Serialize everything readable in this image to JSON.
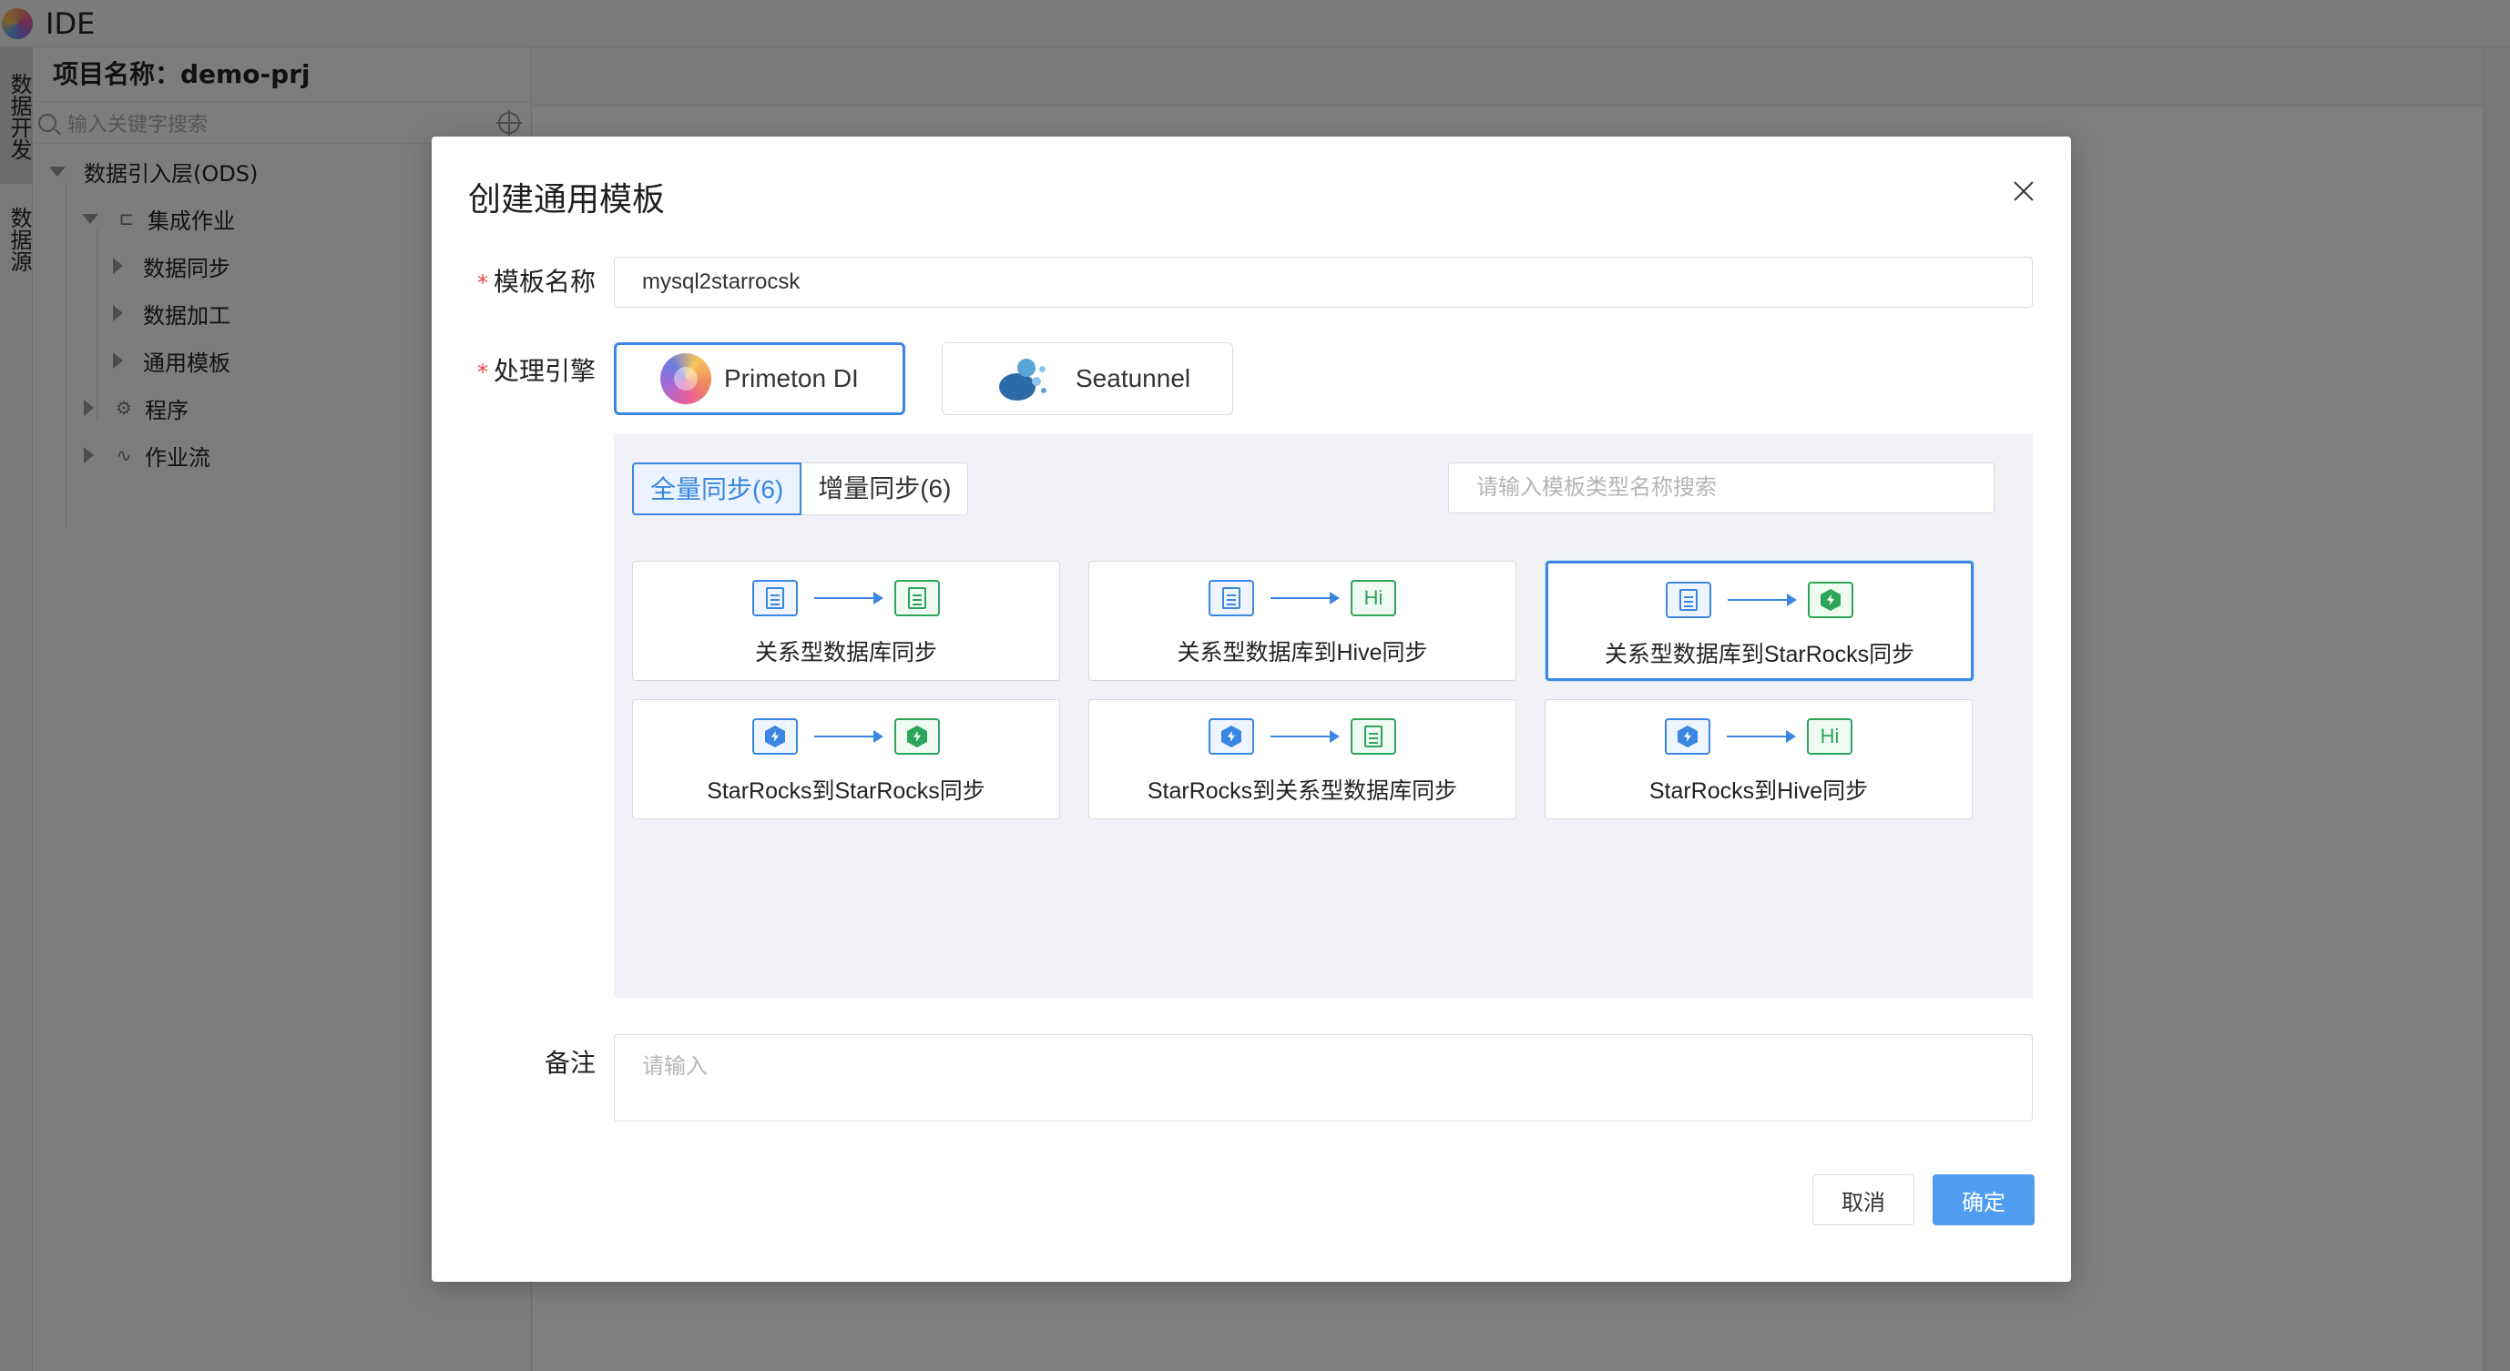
{
  "app": {
    "title": "IDE"
  },
  "vtabs": [
    {
      "label": "数据开发"
    },
    {
      "label": "数据源"
    }
  ],
  "tree": {
    "project_title": "项目名称：demo-prj",
    "search_placeholder": "输入关键字搜索",
    "nodes": {
      "ods": "数据引入层(ODS)",
      "integration": "集成作业",
      "sync": "数据同步",
      "process": "数据加工",
      "template": "通用模板",
      "program": "程序",
      "workflow": "作业流"
    }
  },
  "modal": {
    "title": "创建通用模板",
    "name_label": "模板名称",
    "name_value": "mysql2starrocsk",
    "engine_label": "处理引擎",
    "engines": [
      {
        "label": "Primeton DI",
        "selected": true
      },
      {
        "label": "Seatunnel",
        "selected": false
      }
    ],
    "tabs": {
      "full": "全量同步(6)",
      "incremental": "增量同步(6)"
    },
    "template_search_placeholder": "请输入模板类型名称搜索",
    "cards": [
      {
        "label": "关系型数据库同步",
        "from": "database-doc-icon",
        "to": "database-doc-icon",
        "selected": false
      },
      {
        "label": "关系型数据库到Hive同步",
        "from": "database-doc-icon",
        "to": "Hi",
        "selected": false
      },
      {
        "label": "关系型数据库到StarRocks同步",
        "from": "database-doc-icon",
        "to": "starrocks-icon",
        "selected": true
      },
      {
        "label": "StarRocks到StarRocks同步",
        "from": "starrocks-icon",
        "to": "starrocks-icon",
        "selected": false
      },
      {
        "label": "StarRocks到关系型数据库同步",
        "from": "starrocks-icon",
        "to": "database-doc-icon",
        "selected": false
      },
      {
        "label": "StarRocks到Hive同步",
        "from": "starrocks-icon",
        "to": "Hi",
        "selected": false
      }
    ],
    "remark_label": "备注",
    "remark_placeholder": "请输入",
    "cancel_label": "取消",
    "ok_label": "确定"
  },
  "colors": {
    "accent": "#3b86e0",
    "primary_button": "#4f9cf0",
    "target_green": "#2ca55a",
    "required": "#e8473e"
  }
}
